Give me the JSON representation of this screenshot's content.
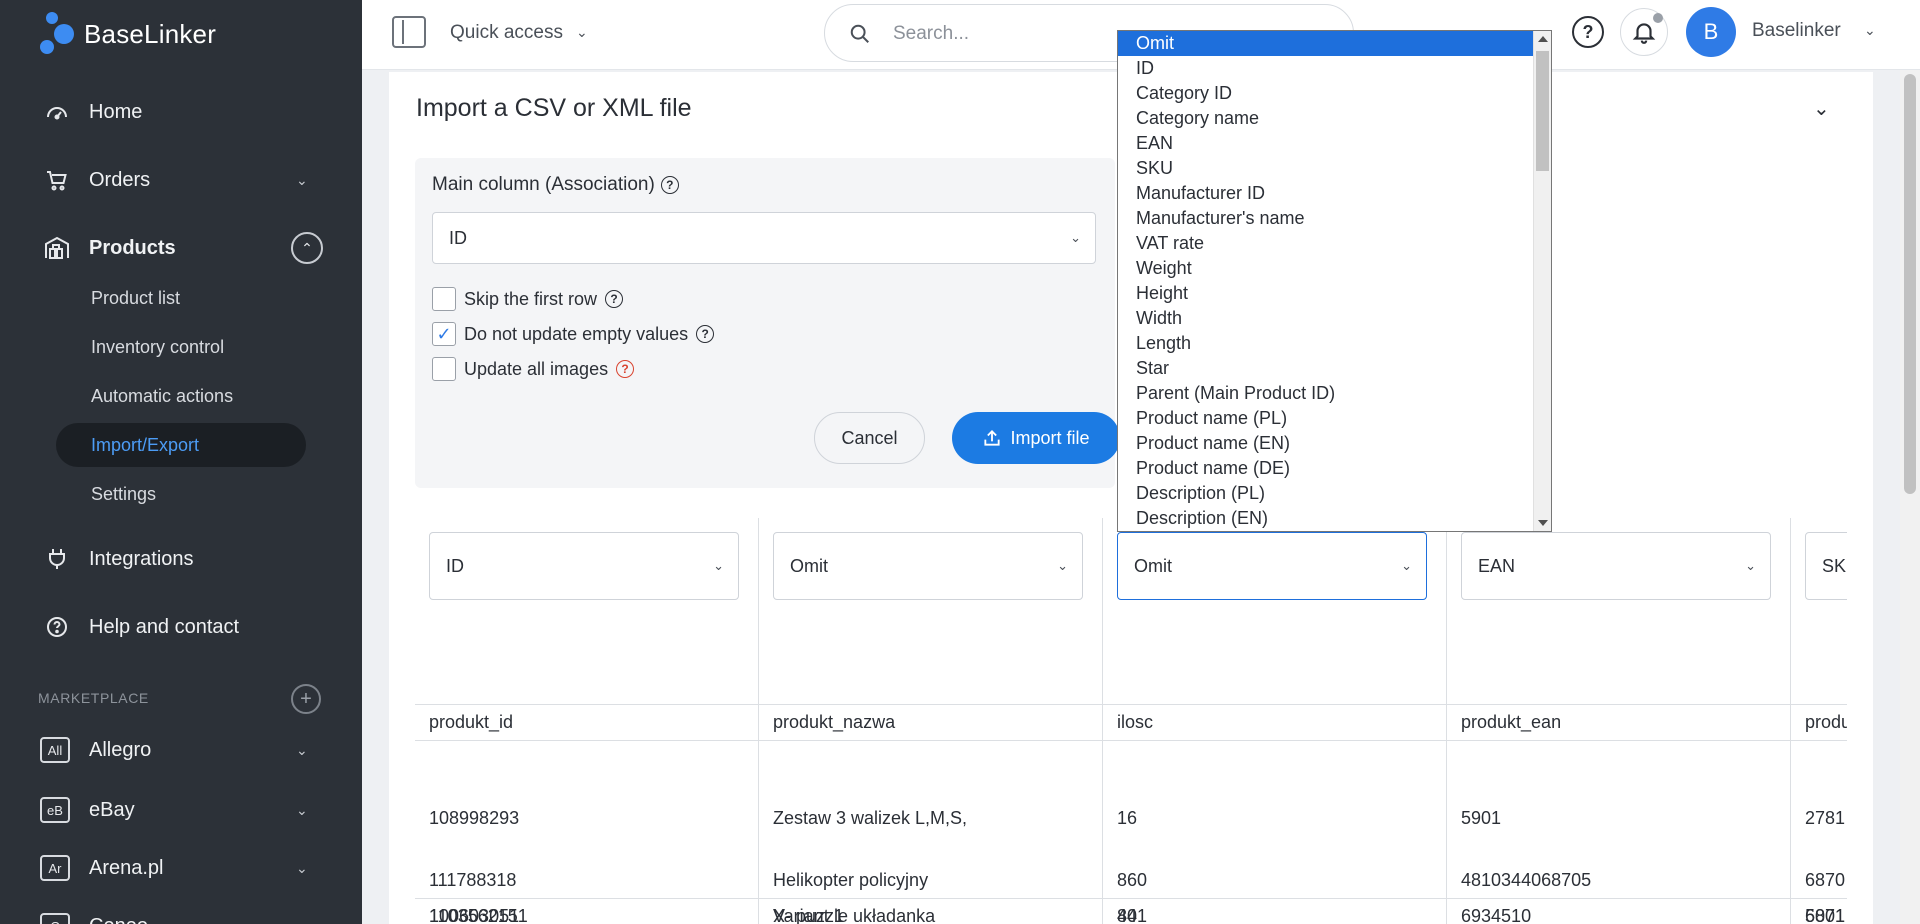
{
  "brand": {
    "name": "BaseLinker",
    "color": "#3d8cf2"
  },
  "sidebar": {
    "items": [
      {
        "label": "Home",
        "icon": "dashboard-icon"
      },
      {
        "label": "Orders",
        "icon": "cart-icon"
      },
      {
        "label": "Products",
        "icon": "warehouse-icon"
      },
      {
        "label": "Integrations",
        "icon": "plug-icon"
      },
      {
        "label": "Help and contact",
        "icon": "help-circle-icon"
      }
    ],
    "products_sub": [
      "Product list",
      "Inventory control",
      "Automatic actions",
      "Import/Export",
      "Settings"
    ],
    "active_sub": "Import/Export",
    "marketplace_label": "MARKETPLACE",
    "marketplaces": [
      {
        "badge": "All",
        "label": "Allegro"
      },
      {
        "badge": "eB",
        "label": "eBay"
      },
      {
        "badge": "Ar",
        "label": "Arena.pl"
      },
      {
        "badge": "C",
        "label": "Ceneo"
      }
    ]
  },
  "topbar": {
    "quick_access": "Quick access",
    "search_placeholder": "Search...",
    "avatar_letter": "B",
    "user_name": "Baselinker"
  },
  "import": {
    "title": "Import a CSV or XML file",
    "assoc_label": "Main column (Association)",
    "assoc_value": "ID",
    "options": [
      {
        "label": "Skip the first row",
        "checked": false,
        "help": "normal"
      },
      {
        "label": "Do not update empty values",
        "checked": true,
        "help": "normal"
      },
      {
        "label": "Update all images",
        "checked": false,
        "help": "red"
      }
    ],
    "cancel_label": "Cancel",
    "import_label": "Import file"
  },
  "table": {
    "column_selects": [
      "ID",
      "Omit",
      "Omit",
      "EAN",
      "SKU"
    ],
    "header_row": [
      "produkt_id",
      "produkt_nazwa",
      "ilosc",
      "produkt_ean",
      "produ"
    ],
    "rows": [
      [
        "108998293",
        "Zestaw 3 walizek L,M,S,",
        "16",
        "5901",
        "2781"
      ],
      [
        "110356215",
        "X- puzzle układanka",
        "40",
        "6934510",
        "5001"
      ],
      [
        "111788318",
        "Helikopter policyjny",
        "860",
        "4810344068705",
        "6870"
      ],
      [
        "1006030511",
        "Variant 1",
        "841",
        "",
        "6871"
      ]
    ]
  },
  "dropdown": {
    "selected": "Omit",
    "options": [
      "Omit",
      "ID",
      "Category ID",
      "Category name",
      "EAN",
      "SKU",
      "Manufacturer ID",
      "Manufacturer's name",
      "VAT rate",
      "Weight",
      "Height",
      "Width",
      "Length",
      "Star",
      "Parent (Main Product ID)",
      "Product name (PL)",
      "Product name (EN)",
      "Product name (DE)",
      "Description (PL)",
      "Description (EN)"
    ]
  },
  "colors": {
    "sidebar_bg": "#2c3138",
    "accent": "#1c7be3",
    "active_sub": "#4c9cf5"
  }
}
